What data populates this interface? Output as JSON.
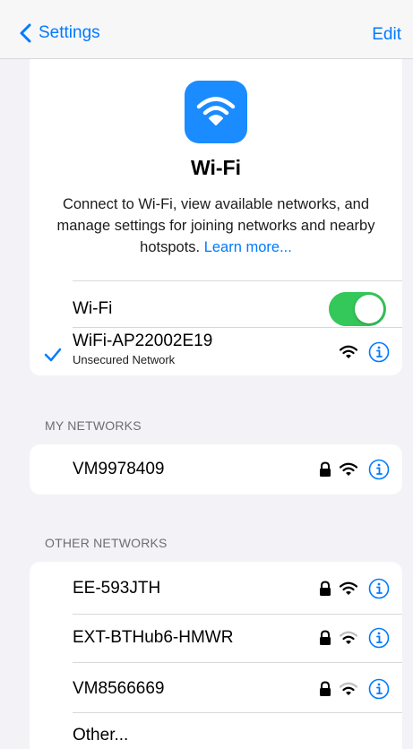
{
  "nav": {
    "back_label": "Settings",
    "edit_label": "Edit"
  },
  "hero": {
    "icon": "wifi-icon",
    "title": "Wi-Fi",
    "description": "Connect to Wi-Fi, view available networks, and manage settings for joining networks and nearby hotspots.",
    "learn_more": "Learn more..."
  },
  "wifi_toggle": {
    "label": "Wi-Fi",
    "on": true
  },
  "connected": {
    "name": "WiFi-AP22002E19",
    "status": "Unsecured Network",
    "locked": false
  },
  "my_networks": {
    "header": "MY NETWORKS",
    "items": [
      {
        "name": "VM9978409",
        "locked": true
      }
    ]
  },
  "other_networks": {
    "header": "OTHER NETWORKS",
    "items": [
      {
        "name": "EE-593JTH",
        "locked": true
      },
      {
        "name": "EXT-BTHub6-HMWR",
        "locked": true
      },
      {
        "name": "VM8566669",
        "locked": true
      },
      {
        "name": "Other...",
        "locked": false
      }
    ]
  },
  "colors": {
    "accent": "#007aff",
    "toggle_on": "#34c759",
    "background": "#f2f2f7"
  }
}
